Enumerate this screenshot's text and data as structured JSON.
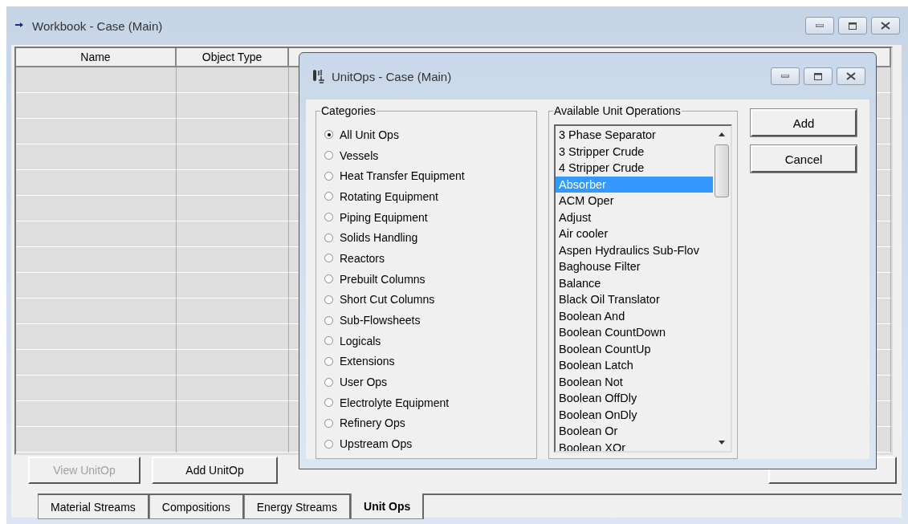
{
  "workbook": {
    "title": "Workbook - Case (Main)",
    "columns": [
      "Name",
      "Object Type"
    ],
    "buttons": [
      {
        "label": "View UnitOp",
        "disabled": true
      },
      {
        "label": "Add UnitOp",
        "disabled": false
      }
    ],
    "tabs": [
      {
        "label": "Material Streams",
        "selected": false
      },
      {
        "label": "Compositions",
        "selected": false
      },
      {
        "label": "Energy Streams",
        "selected": false
      },
      {
        "label": "Unit Ops",
        "selected": true
      }
    ]
  },
  "dialog": {
    "title": "UnitOps - Case (Main)",
    "categories_label": "Categories",
    "categories": [
      {
        "label": "All Unit Ops",
        "selected": true
      },
      {
        "label": "Vessels",
        "selected": false
      },
      {
        "label": "Heat Transfer Equipment",
        "selected": false
      },
      {
        "label": "Rotating Equipment",
        "selected": false
      },
      {
        "label": "Piping Equipment",
        "selected": false
      },
      {
        "label": "Solids Handling",
        "selected": false
      },
      {
        "label": "Reactors",
        "selected": false
      },
      {
        "label": "Prebuilt Columns",
        "selected": false
      },
      {
        "label": "Short Cut Columns",
        "selected": false
      },
      {
        "label": "Sub-Flowsheets",
        "selected": false
      },
      {
        "label": "Logicals",
        "selected": false
      },
      {
        "label": "Extensions",
        "selected": false
      },
      {
        "label": "User Ops",
        "selected": false
      },
      {
        "label": "Electrolyte Equipment",
        "selected": false
      },
      {
        "label": "Refinery Ops",
        "selected": false
      },
      {
        "label": "Upstream Ops",
        "selected": false
      }
    ],
    "operations_label": "Available Unit Operations",
    "operations": [
      {
        "label": "3 Phase Separator",
        "selected": false
      },
      {
        "label": "3 Stripper Crude",
        "selected": false
      },
      {
        "label": "4 Stripper Crude",
        "selected": false
      },
      {
        "label": "Absorber",
        "selected": true
      },
      {
        "label": "ACM Oper",
        "selected": false
      },
      {
        "label": "Adjust",
        "selected": false
      },
      {
        "label": "Air cooler",
        "selected": false
      },
      {
        "label": "Aspen Hydraulics Sub-Flov",
        "selected": false
      },
      {
        "label": "Baghouse Filter",
        "selected": false
      },
      {
        "label": "Balance",
        "selected": false
      },
      {
        "label": "Black Oil Translator",
        "selected": false
      },
      {
        "label": "Boolean And",
        "selected": false
      },
      {
        "label": "Boolean CountDown",
        "selected": false
      },
      {
        "label": "Boolean CountUp",
        "selected": false
      },
      {
        "label": "Boolean Latch",
        "selected": false
      },
      {
        "label": "Boolean Not",
        "selected": false
      },
      {
        "label": "Boolean OffDly",
        "selected": false
      },
      {
        "label": "Boolean OnDly",
        "selected": false
      },
      {
        "label": "Boolean Or",
        "selected": false
      },
      {
        "label": "Boolean XOr",
        "selected": false
      }
    ],
    "buttons": [
      "Add",
      "Cancel"
    ]
  }
}
